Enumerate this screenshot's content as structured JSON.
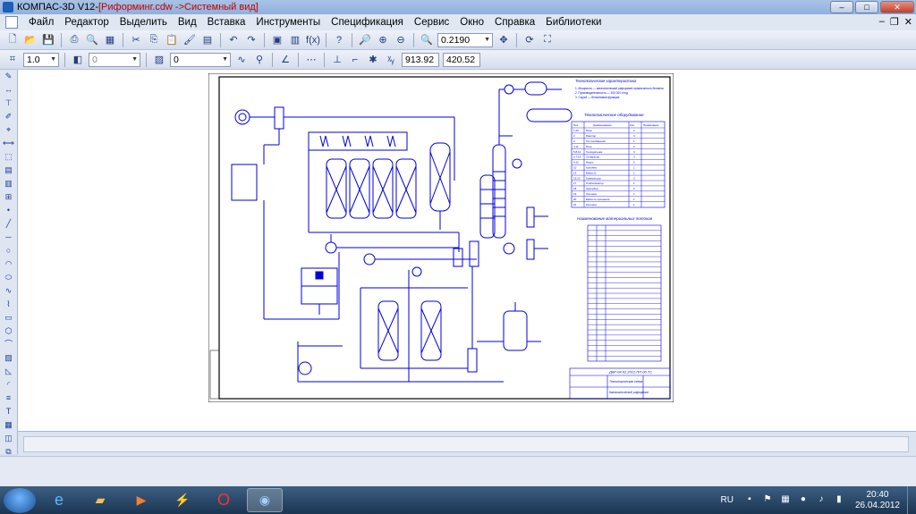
{
  "window": {
    "app_name": "КОМПАС-3D V12",
    "separator": " - ",
    "document": "[Риформинг.cdw ->Системный вид]"
  },
  "menu": [
    "Файл",
    "Редактор",
    "Выделить",
    "Вид",
    "Вставка",
    "Инструменты",
    "Спецификация",
    "Сервис",
    "Окно",
    "Справка",
    "Библиотеки"
  ],
  "toolbar1": {
    "zoom": "0.2190"
  },
  "toolbar2": {
    "line_scale": "1.0",
    "layer": "0",
    "style": "0",
    "coord_x": "913.92",
    "coord_y": "420.52"
  },
  "drawing": {
    "tech_title": "Технологическая характеристика",
    "tech_notes": [
      "1. Мощность — каталитический риформинг прямогонного бензина",
      "2. Производительность — 300 000 т/год",
      "3. Сырьё — бензиновая фракция"
    ],
    "equipment_title": "Технологическое оборудование",
    "equipment_header": [
      "Поз.",
      "Наименование",
      "Кол.",
      "Примечание"
    ],
    "equipment_rows": [
      [
        "1,23",
        "Печь",
        "2"
      ],
      [
        "2",
        "Реактор",
        "4"
      ],
      [
        "3",
        "Теплообменник",
        "1"
      ],
      [
        "4,11",
        "Печь",
        "2"
      ],
      [
        "5,8,14",
        "Холодильник",
        "4"
      ],
      [
        "6,7,16",
        "Сепаратор",
        "3"
      ],
      [
        "9,12",
        "Насос",
        "6"
      ],
      [
        "10",
        "Колонна",
        "1"
      ],
      [
        "13",
        "Емкость",
        "1"
      ],
      [
        "15,22",
        "Компрессор",
        "2"
      ],
      [
        "17",
        "Стабилизатор",
        "1"
      ],
      [
        "18",
        "Адсорбер",
        "2"
      ],
      [
        "19",
        "Колонна",
        "1"
      ],
      [
        "20",
        "Емкость орошения",
        "1"
      ],
      [
        "21",
        "Колонна",
        "1"
      ]
    ],
    "flows_title": "Наименование материальных потоков",
    "stamp_doc": "ДКР-04.02.2012.ПП.00.ТС",
    "stamp_title": "Технологическая схема",
    "stamp_sub": "Каталитический риформинг"
  },
  "taskbar": {
    "lang": "RU",
    "time": "20:40",
    "date": "26.04.2012"
  }
}
